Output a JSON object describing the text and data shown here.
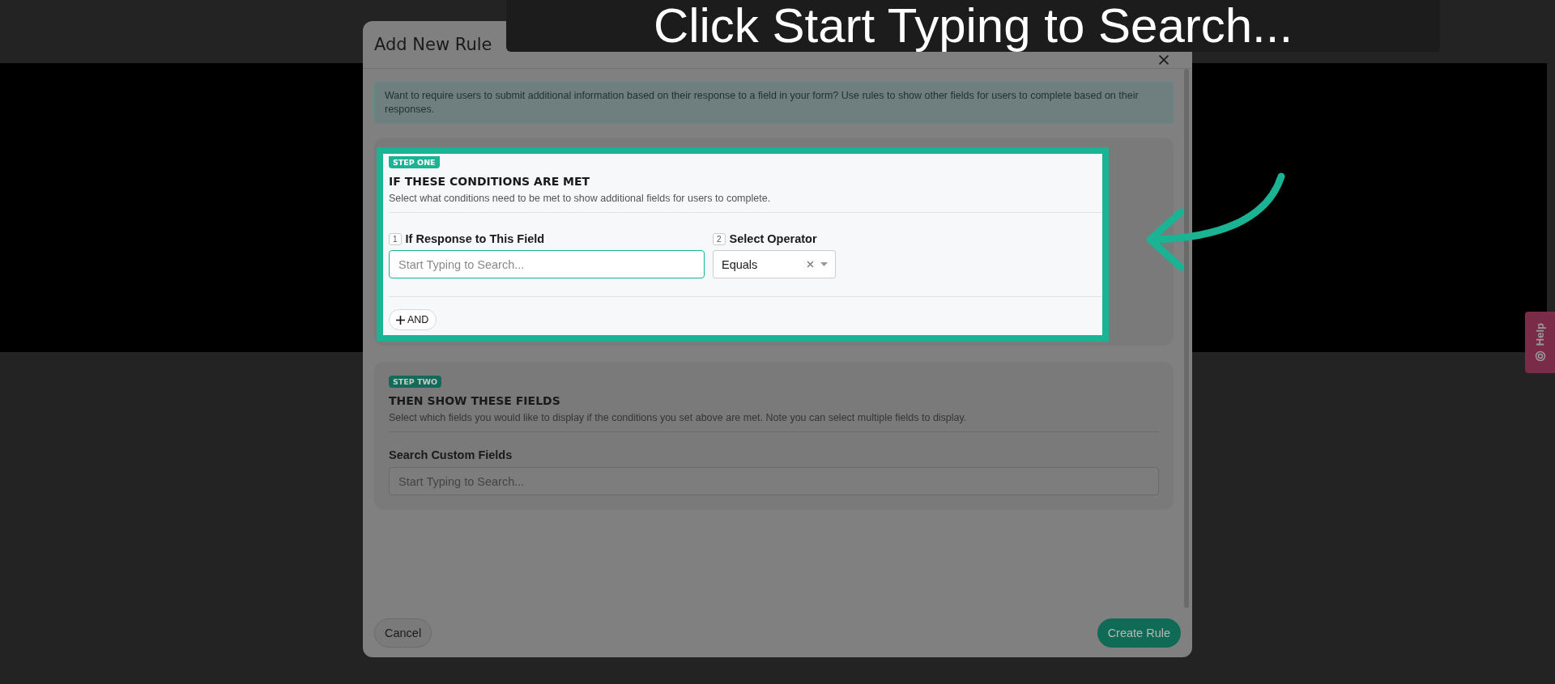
{
  "caption": {
    "text": "Click Start Typing to Search..."
  },
  "modal": {
    "title": "Add New Rule",
    "info": "Want to require users to submit additional information based on their response to a field in your form? Use rules to show other fields for users to complete based on their responses.",
    "step_one": {
      "badge": "STEP ONE",
      "title": "IF THESE CONDITIONS ARE MET",
      "description": "Select what conditions need to be met to show additional fields for users to complete.",
      "highlighted": true,
      "fields": [
        {
          "kind": "text",
          "number": "1",
          "label": "If Response to This Field",
          "placeholder": "Start Typing to Search...",
          "focused": true
        },
        {
          "kind": "select",
          "number": "2",
          "label": "Select Operator",
          "value": "Equals",
          "focused": false
        }
      ],
      "add_button": "AND"
    },
    "step_two": {
      "badge": "STEP TWO",
      "title": "THEN SHOW THESE FIELDS",
      "description": "Select which fields you would like to display if the conditions you set above are met. Note you can select multiple fields to display.",
      "field_label": "Search Custom Fields",
      "placeholder": "Start Typing to Search..."
    },
    "buttons": {
      "cancel": "Cancel",
      "create": "Create Rule"
    }
  },
  "help_tab": {
    "label": "Help"
  }
}
